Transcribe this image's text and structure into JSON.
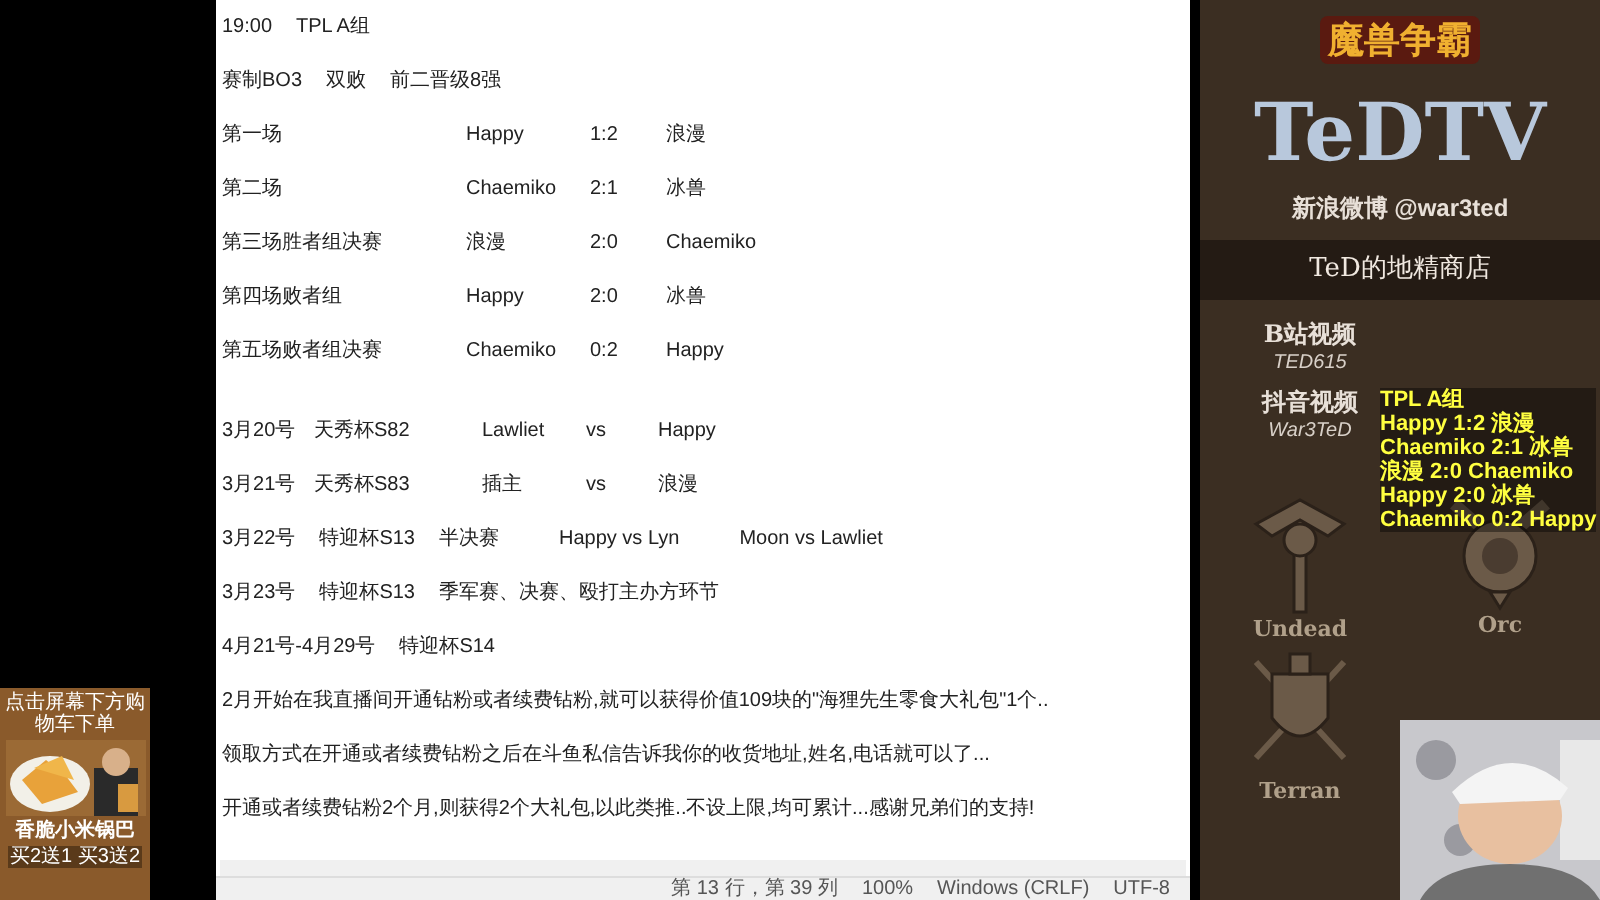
{
  "notepad": {
    "results": [
      {
        "kind": "plain",
        "cells": [
          "19:00",
          "TPL A组"
        ]
      },
      {
        "kind": "plain",
        "cells": [
          "赛制BO3",
          "双败",
          "前二晋级8强"
        ]
      },
      {
        "kind": "match",
        "cells": [
          "第一场",
          "Happy",
          "1:2",
          "浪漫"
        ]
      },
      {
        "kind": "match",
        "cells": [
          "第二场",
          "Chaemiko",
          "2:1",
          "冰兽"
        ]
      },
      {
        "kind": "match",
        "cells": [
          "第三场胜者组决赛",
          "浪漫",
          "2:0",
          "Chaemiko"
        ]
      },
      {
        "kind": "match",
        "cells": [
          "第四场败者组",
          "Happy",
          "2:0",
          "冰兽"
        ]
      },
      {
        "kind": "match",
        "cells": [
          "第五场败者组决赛",
          "Chaemiko",
          "0:2",
          "Happy"
        ]
      }
    ],
    "schedule": [
      {
        "kind": "fixture",
        "cells": [
          "3月20号",
          "天秀杯S82",
          "Lawliet",
          "vs",
          "Happy"
        ]
      },
      {
        "kind": "fixture",
        "cells": [
          "3月21号",
          "天秀杯S83",
          "插主",
          "vs",
          "浪漫"
        ]
      },
      {
        "kind": "plain",
        "cells": [
          "3月22号",
          "特迎杯S13",
          "半决赛",
          "Happy  vs  Lyn",
          "Moon   vs   Lawliet"
        ]
      },
      {
        "kind": "plain",
        "cells": [
          "3月23号",
          "特迎杯S13",
          "季军赛、决赛、殴打主办方环节"
        ]
      },
      {
        "kind": "plain",
        "cells": [
          "4月21号-4月29号",
          "特迎杯S14"
        ]
      },
      {
        "kind": "plain",
        "cells": [
          "2月开始在我直播间开通钻粉或者续费钻粉,就可以获得价值109块的\"海狸先生零食大礼包\"1个.."
        ]
      },
      {
        "kind": "plain",
        "cells": [
          "领取方式在开通或者续费钻粉之后在斗鱼私信告诉我你的收货地址,姓名,电话就可以了..."
        ]
      },
      {
        "kind": "plain",
        "cells": [
          "开通或者续费钻粉2个月,则获得2个大礼包,以此类推..不设上限,均可累计...感谢兄弟们的支持!"
        ]
      }
    ],
    "status_bar": [
      "第 13 行，第 39 列",
      "100%",
      "Windows (CRLF)",
      "UTF-8"
    ]
  },
  "ad": {
    "top_text": "点击屏幕下方购物车下单",
    "title": "香脆小米锅巴",
    "offer": "买2送1 买3送2"
  },
  "panel": {
    "game_logo": "魔兽争霸",
    "brand": "TeDTV",
    "weibo": "新浪微博 @war3ted",
    "shop": "TeD的地精商店",
    "videos": [
      {
        "label": "B站视频",
        "handle": "TED615"
      },
      {
        "label": "抖音视频",
        "handle": "War3TeD"
      }
    ],
    "races": [
      {
        "kind": "undead",
        "label": "Undead"
      },
      {
        "kind": "orc",
        "label": "Orc"
      },
      {
        "kind": "terran",
        "label": "Terran"
      }
    ]
  },
  "overlay_lines": [
    "TPL A组",
    "Happy 1:2 浪漫",
    "Chaemiko 2:1 冰兽",
    "浪漫 2:0 Chaemiko",
    "Happy 2:0 冰兽",
    "Chaemiko 0:2 Happy"
  ]
}
